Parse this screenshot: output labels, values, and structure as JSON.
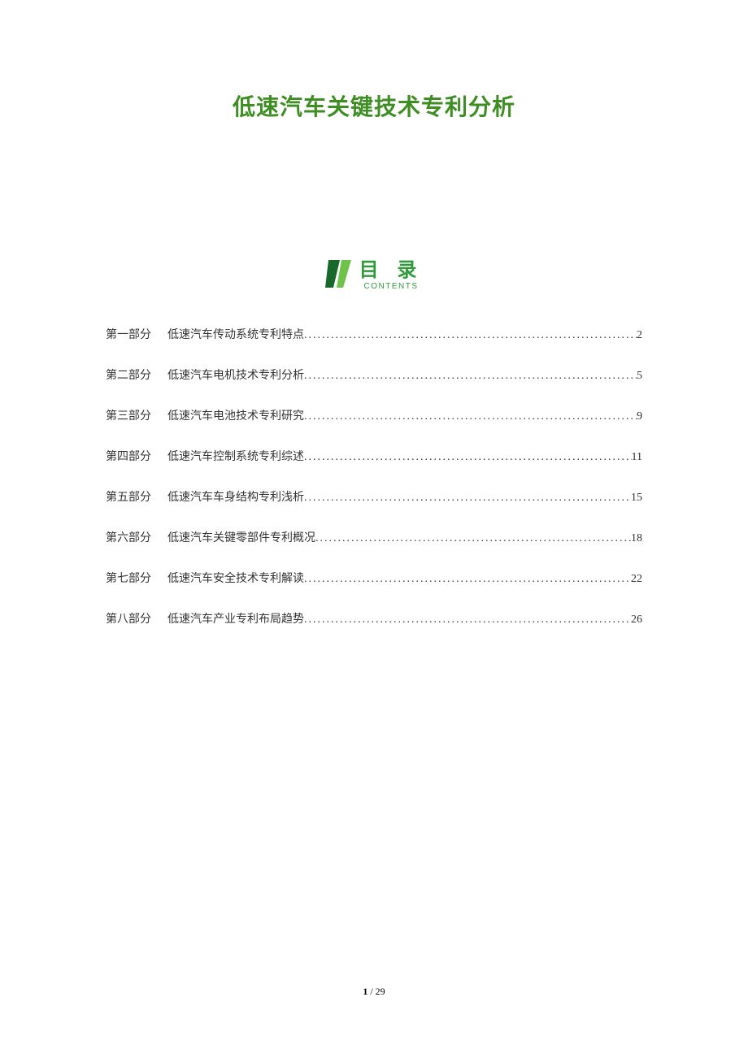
{
  "title": "低速汽车关键技术专利分析",
  "toc_header": {
    "title": "目 录",
    "subtitle": "CONTENTS"
  },
  "toc": [
    {
      "part": "第一部分",
      "desc": "低速汽车传动系统专利特点",
      "page": "2"
    },
    {
      "part": "第二部分",
      "desc": "低速汽车电机技术专利分析",
      "page": "5"
    },
    {
      "part": "第三部分",
      "desc": "低速汽车电池技术专利研究",
      "page": "9"
    },
    {
      "part": "第四部分",
      "desc": "低速汽车控制系统专利综述",
      "page": "11"
    },
    {
      "part": "第五部分",
      "desc": "低速汽车车身结构专利浅析",
      "page": "15"
    },
    {
      "part": "第六部分",
      "desc": "低速汽车关键零部件专利概况",
      "page": "18"
    },
    {
      "part": "第七部分",
      "desc": "低速汽车安全技术专利解读",
      "page": "22"
    },
    {
      "part": "第八部分",
      "desc": "低速汽车产业专利布局趋势",
      "page": "26"
    }
  ],
  "footer": {
    "current": "1",
    "sep": " / ",
    "total": "29"
  }
}
